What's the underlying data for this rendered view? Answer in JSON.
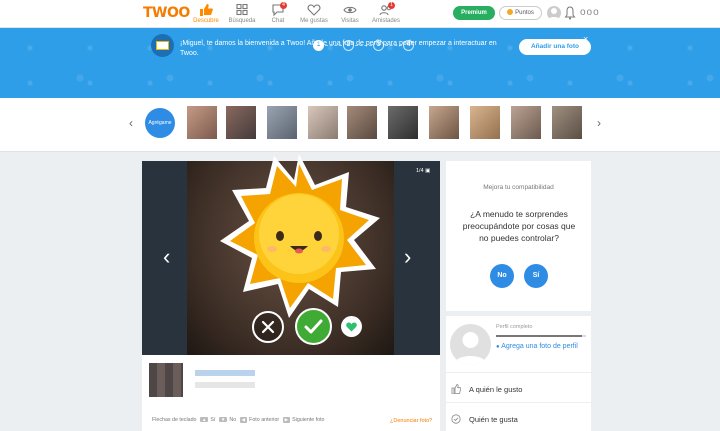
{
  "header": {
    "logo": "TWOO",
    "nav": [
      {
        "label": "Descubre",
        "icon": "thumbs-up-icon",
        "active": true
      },
      {
        "label": "Búsqueda",
        "icon": "grid-icon"
      },
      {
        "label": "Chat",
        "icon": "chat-icon",
        "badge": "4"
      },
      {
        "label": "Me gustas",
        "icon": "heart-icon"
      },
      {
        "label": "Visitas",
        "icon": "eye-icon"
      },
      {
        "label": "Amistades",
        "icon": "friends-icon",
        "badge": "1"
      }
    ],
    "premium_label": "Premium",
    "puntos_label": "Puntos",
    "more_label": "ooo"
  },
  "banner": {
    "steps": [
      "1",
      "2",
      "3",
      "4"
    ],
    "active_step": "1",
    "close_label": "×",
    "text": "¡Miguel, te damos la bienvenida a Twoo! Añade una foto de perfil para poder empezar a interactuar en Twoo.",
    "button_label": "Añadir una foto"
  },
  "strip": {
    "add_label": "Agrégame",
    "prev_label": "‹",
    "next_label": "›"
  },
  "photo": {
    "counter": "1/4",
    "prev_label": "‹",
    "next_label": "›"
  },
  "keyboard": {
    "prefix": "Flechas de teclado",
    "up_key": "▲",
    "yes": "Sí",
    "down_key": "▼",
    "no": "No",
    "left_key": "◀",
    "prev_photo": "Foto anterior",
    "right_key": "▶",
    "next_photo": "Siguiente foto"
  },
  "report_label": "¿Denunciar foto?",
  "compat": {
    "title": "Mejora tu compatibilidad",
    "question": "¿A menudo te sorprendes preocupándote por cosas que no puedes controlar?",
    "no_label": "No",
    "yes_label": "Sí"
  },
  "profile": {
    "label": "Perfil completo",
    "progress": 0.95,
    "link": "Agrega una foto de perfil",
    "menu": [
      "A quién le gusto",
      "Quién te gusta"
    ]
  },
  "colors": {
    "brand_orange": "#f57c00",
    "banner_blue": "#2f9ee8",
    "premium_green": "#27ae60",
    "action_blue": "#2f8ce5"
  }
}
